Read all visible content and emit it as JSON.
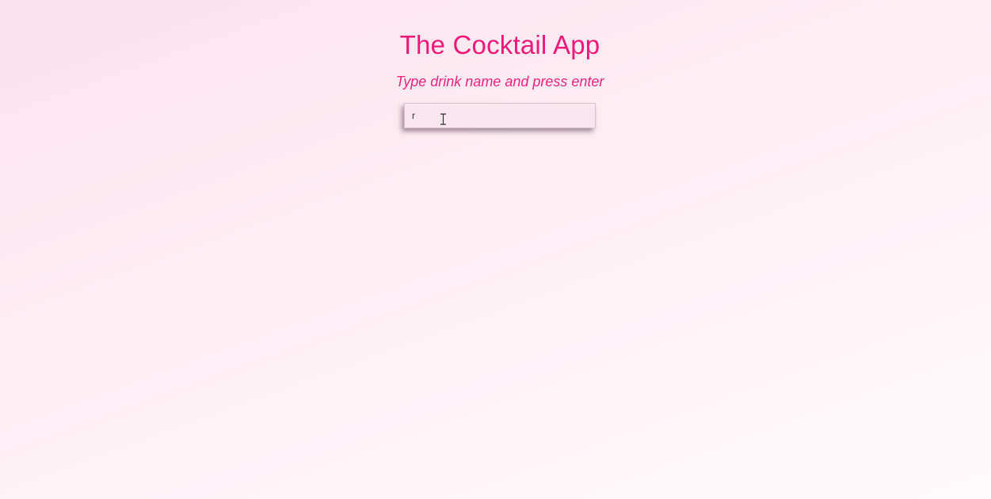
{
  "header": {
    "title": "The Cocktail App",
    "subtitle": "Type drink name and press enter"
  },
  "search": {
    "value": "r",
    "placeholder": ""
  },
  "colors": {
    "accent": "#f0197a",
    "input_background": "#fae6ef",
    "page_background": "#fdeef4"
  },
  "icons": {
    "cursor": "text-cursor-icon"
  }
}
